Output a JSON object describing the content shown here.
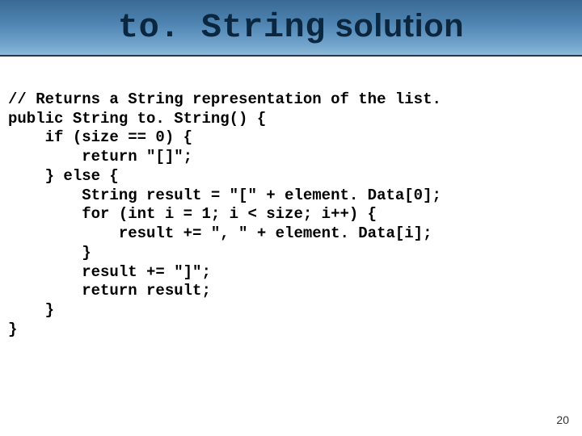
{
  "title": {
    "mono_part": "to. String",
    "rest": " solution"
  },
  "code": {
    "l01": "// Returns a String representation of the list.",
    "l02": "public String to. String() {",
    "l03": "    if (size == 0) {",
    "l04": "        return \"[]\";",
    "l05": "    } else {",
    "l06": "        String result = \"[\" + element. Data[0];",
    "l07": "        for (int i = 1; i < size; i++) {",
    "l08": "            result += \", \" + element. Data[i];",
    "l09": "        }",
    "l10": "        result += \"]\";",
    "l11": "        return result;",
    "l12": "    }",
    "l13": "}"
  },
  "page_number": "20"
}
